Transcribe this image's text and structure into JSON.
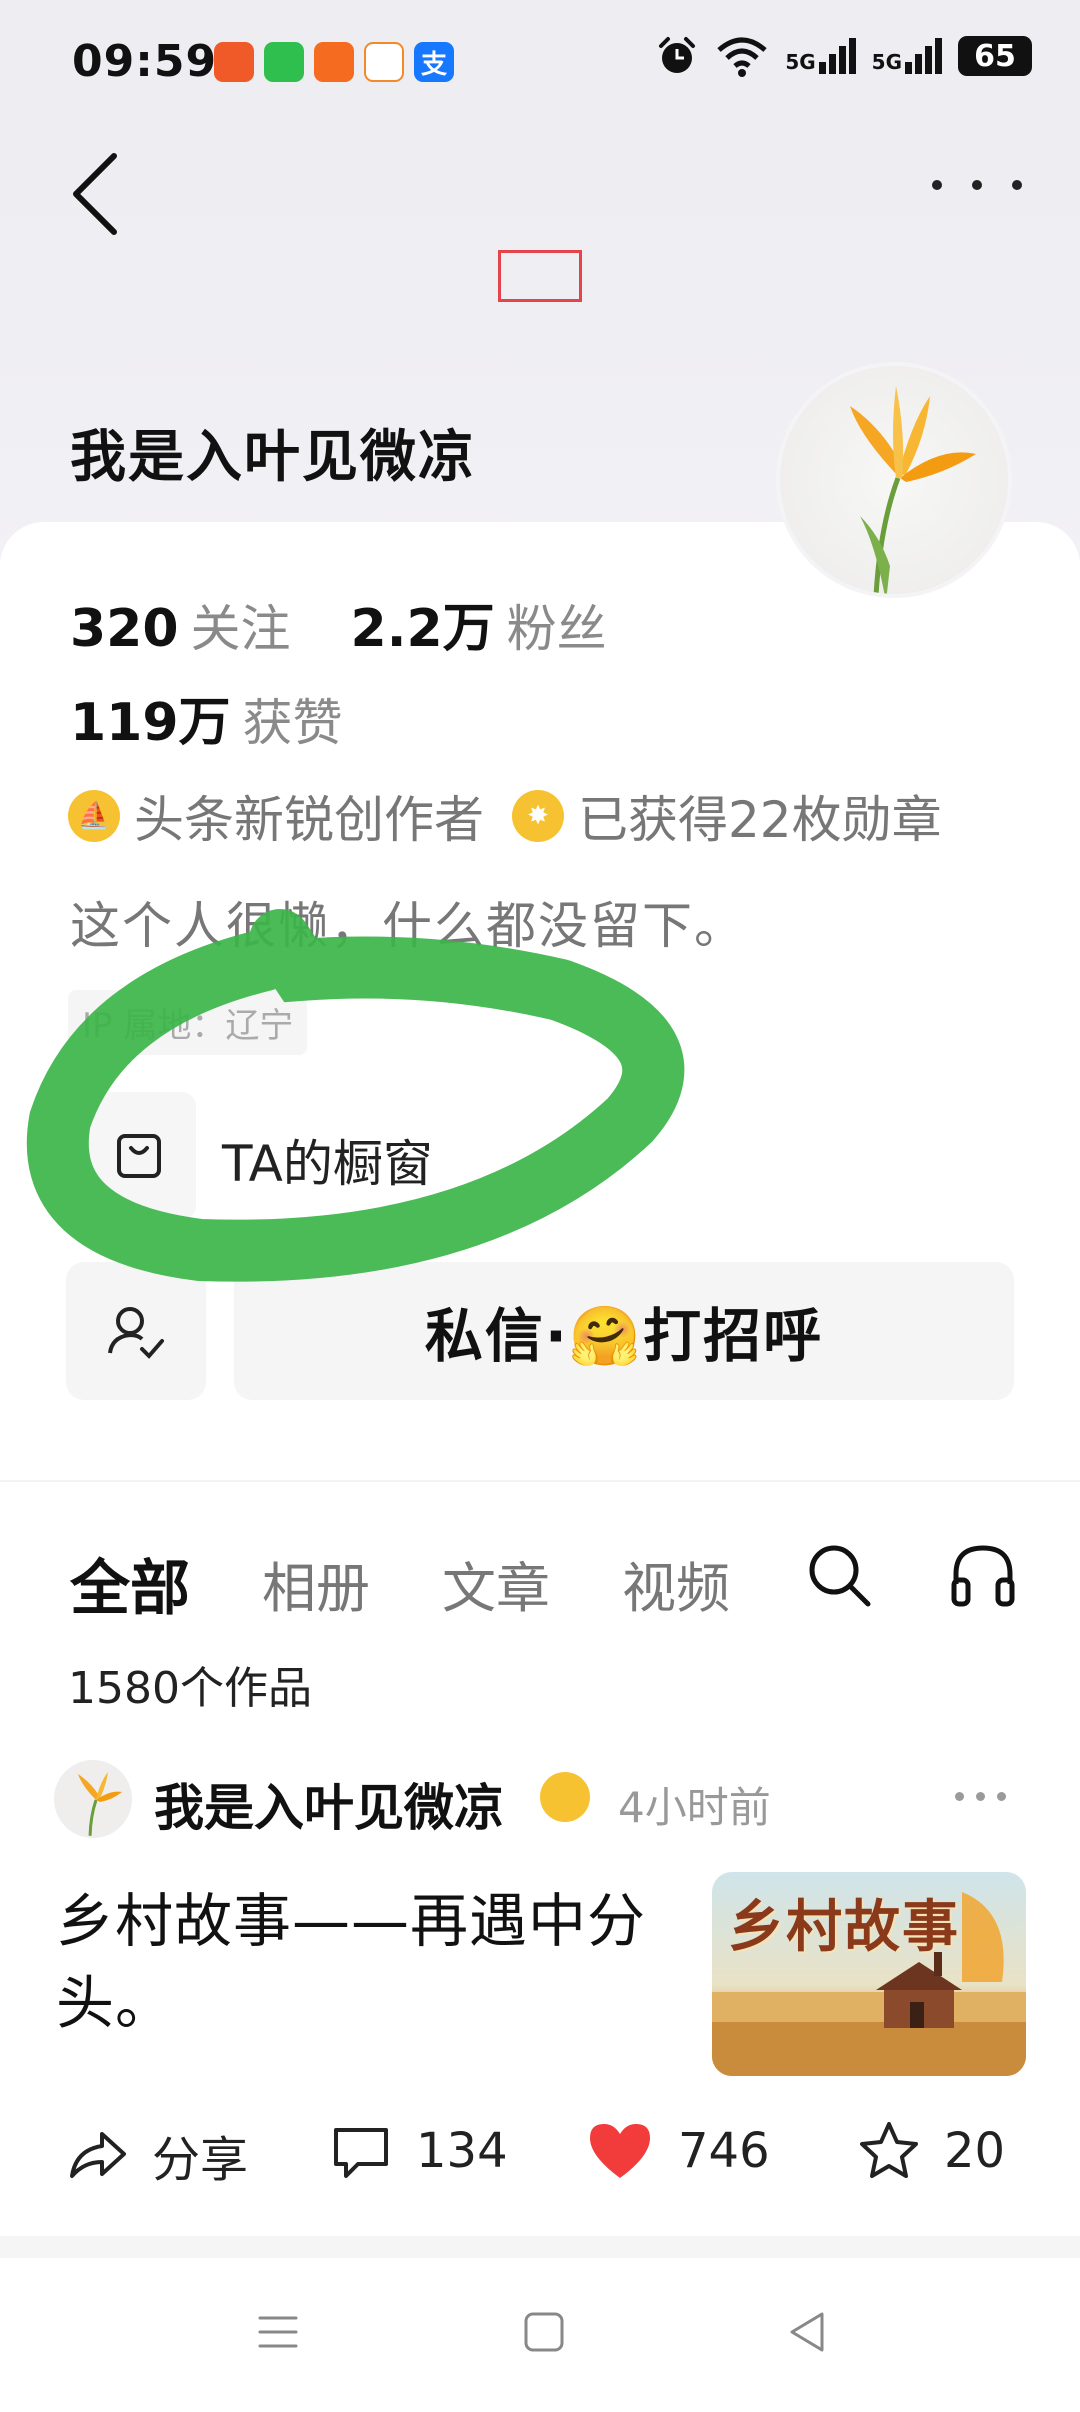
{
  "status_bar": {
    "time": "09:59",
    "notif_apps": [
      {
        "name": "home-app-icon",
        "label": "",
        "color": "#f05a28"
      },
      {
        "name": "message-app-icon",
        "label": "",
        "color": "#2fbf4f"
      },
      {
        "name": "taobao-app-icon",
        "label": "",
        "color": "#f56b1f"
      },
      {
        "name": "didi-app-icon",
        "label": "",
        "color": "#ffffff"
      },
      {
        "name": "alipay-app-icon",
        "label": "支",
        "color": "#1677ff"
      }
    ],
    "signal_1": "5G",
    "signal_2": "5G",
    "battery": "65"
  },
  "profile": {
    "name": "我是入叶见微凉",
    "following_count": "320",
    "following_label": "关注",
    "followers_count": "2.2万",
    "followers_label": "粉丝",
    "likes_count": "119万",
    "likes_label": "获赞",
    "badge_creator": "头条新锐创作者",
    "badge_medals": "已获得22枚勋章",
    "bio": "这个人很懒，什么都没留下。",
    "ip_location": "IP 属地：辽宁",
    "showcase_label": "TA的橱窗",
    "message_button_label": "私信·🤗打招呼"
  },
  "tabs": {
    "items": [
      "全部",
      "相册",
      "文章",
      "视频"
    ],
    "active": "全部",
    "works_count": "1580个作品"
  },
  "post": {
    "author": "我是入叶见微凉",
    "time": "4小时前",
    "text": "乡村故事——再遇中分头。",
    "thumbnail_title": "乡村故事",
    "share_label": "分享",
    "comments": "134",
    "likes": "746",
    "favorites": "20"
  },
  "colors": {
    "accent_red": "#f23b3b",
    "badge_yellow": "#f6c231",
    "annotation_green": "#3cb54a",
    "annotation_red": "#e6444d"
  }
}
